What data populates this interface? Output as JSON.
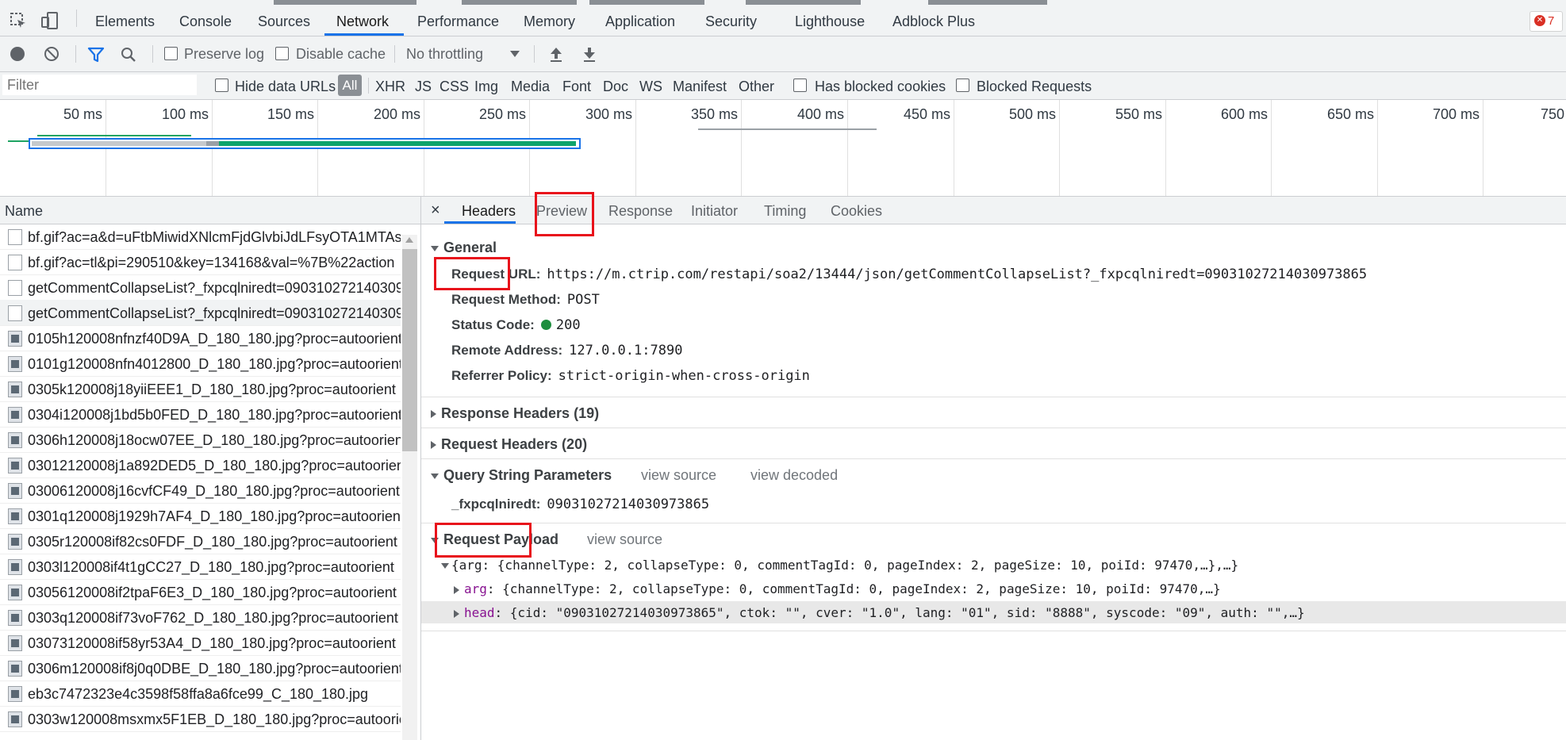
{
  "devtools": {
    "tabs": [
      "Elements",
      "Console",
      "Sources",
      "Network",
      "Performance",
      "Memory",
      "Application",
      "Security",
      "Lighthouse",
      "Adblock Plus"
    ],
    "active_tab": "Network",
    "error_count": "7"
  },
  "toolbar": {
    "preserve_log": "Preserve log",
    "disable_cache": "Disable cache",
    "throttling": "No throttling"
  },
  "filter": {
    "placeholder": "Filter",
    "hide_data_urls": "Hide data URLs",
    "types": [
      "All",
      "XHR",
      "JS",
      "CSS",
      "Img",
      "Media",
      "Font",
      "Doc",
      "WS",
      "Manifest",
      "Other"
    ],
    "has_blocked_cookies": "Has blocked cookies",
    "blocked_requests": "Blocked Requests"
  },
  "timeline": {
    "ticks": [
      "50 ms",
      "100 ms",
      "150 ms",
      "200 ms",
      "250 ms",
      "300 ms",
      "350 ms",
      "400 ms",
      "450 ms",
      "500 ms",
      "550 ms",
      "600 ms",
      "650 ms",
      "700 ms",
      "750"
    ]
  },
  "requests": {
    "header": "Name",
    "items": [
      {
        "name": "bf.gif?ac=a&d=uFtbMiwidXNlcmFjdGlvbiJdLFsyOTA1MTAs...",
        "icon": "doc"
      },
      {
        "name": "bf.gif?ac=tl&pi=290510&key=134168&val=%7B%22action",
        "icon": "doc"
      },
      {
        "name": "getCommentCollapseList?_fxpcqlniredt=090310272140309...",
        "icon": "doc"
      },
      {
        "name": "getCommentCollapseList?_fxpcqlniredt=090310272140309...",
        "icon": "doc"
      },
      {
        "name": "0105h120008nfnzf40D9A_D_180_180.jpg?proc=autoorient",
        "icon": "img"
      },
      {
        "name": "0101g120008nfn4012800_D_180_180.jpg?proc=autoorient",
        "icon": "img"
      },
      {
        "name": "0305k120008j18yiiEEE1_D_180_180.jpg?proc=autoorient",
        "icon": "img"
      },
      {
        "name": "0304i120008j1bd5b0FED_D_180_180.jpg?proc=autoorient",
        "icon": "img"
      },
      {
        "name": "0306h120008j18ocw07EE_D_180_180.jpg?proc=autoorient",
        "icon": "img"
      },
      {
        "name": "03012120008j1a892DED5_D_180_180.jpg?proc=autoorient",
        "icon": "img"
      },
      {
        "name": "03006120008j16cvfCF49_D_180_180.jpg?proc=autoorient",
        "icon": "img"
      },
      {
        "name": "0301q120008j1929h7AF4_D_180_180.jpg?proc=autoorient",
        "icon": "img"
      },
      {
        "name": "0305r120008if82cs0FDF_D_180_180.jpg?proc=autoorient",
        "icon": "img"
      },
      {
        "name": "0303l120008if4t1gCC27_D_180_180.jpg?proc=autoorient",
        "icon": "img"
      },
      {
        "name": "03056120008if2tpaF6E3_D_180_180.jpg?proc=autoorient",
        "icon": "img"
      },
      {
        "name": "0303q120008if73voF762_D_180_180.jpg?proc=autoorient",
        "icon": "img"
      },
      {
        "name": "03073120008if58yr53A4_D_180_180.jpg?proc=autoorient",
        "icon": "img"
      },
      {
        "name": "0306m120008if8j0q0DBE_D_180_180.jpg?proc=autoorient",
        "icon": "img"
      },
      {
        "name": "eb3c7472323e4c3598f58ffa8a6fce99_C_180_180.jpg",
        "icon": "img"
      },
      {
        "name": "0303w120008msxmx5F1EB_D_180_180.jpg?proc=autoorien",
        "icon": "img"
      }
    ]
  },
  "detail": {
    "close": "×",
    "tabs": [
      "Headers",
      "Preview",
      "Response",
      "Initiator",
      "Timing",
      "Cookies"
    ],
    "active_tab": "Headers",
    "general": {
      "title": "General",
      "request_url_label": "Request URL:",
      "request_url": "https://m.ctrip.com/restapi/soa2/13444/json/getCommentCollapseList?_fxpcqlniredt=09031027214030973865",
      "request_method_label": "Request Method:",
      "request_method": "POST",
      "status_code_label": "Status Code:",
      "status_code": "200",
      "remote_address_label": "Remote Address:",
      "remote_address": "127.0.0.1:7890",
      "referrer_policy_label": "Referrer Policy:",
      "referrer_policy": "strict-origin-when-cross-origin"
    },
    "response_headers": "Response Headers (19)",
    "request_headers": "Request Headers (20)",
    "query": {
      "title": "Query String Parameters",
      "view_source": "view source",
      "view_decoded": "view decoded",
      "param_key": "_fxpcqlniredt:",
      "param_value": "09031027214030973865"
    },
    "payload": {
      "title": "Request Payload",
      "view_source": "view source",
      "root": "{arg: {channelType: 2, collapseType: 0, commentTagId: 0, pageIndex: 2, pageSize: 10, poiId: 97470,…},…}",
      "arg_key": "arg",
      "arg_value": "{channelType: 2, collapseType: 0, commentTagId: 0, pageIndex: 2, pageSize: 10, poiId: 97470,…}",
      "head_key": "head",
      "head_value": "{cid: \"09031027214030973865\", ctok: \"\", cver: \"1.0\", lang: \"01\", sid: \"8888\", syscode: \"09\", auth: \"\",…}"
    }
  },
  "colors": {
    "accent": "#1a73e8",
    "highlight_box": "#e8121b",
    "status_ok": "#1e8e3e",
    "payload_key": "#881391"
  }
}
